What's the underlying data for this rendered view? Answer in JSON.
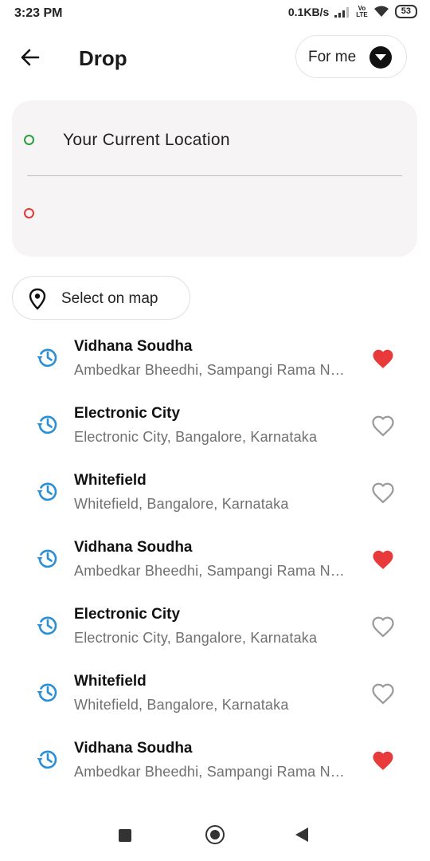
{
  "status_bar": {
    "time": "3:23 PM",
    "network_speed": "0.1KB/s",
    "battery": "53"
  },
  "header": {
    "title": "Drop",
    "for_me_label": "For me"
  },
  "locations": {
    "pickup": "Your Current Location",
    "drop_value": ""
  },
  "select_on_map": {
    "label": "Select on map"
  },
  "recent_places": [
    {
      "name": "Vidhana Soudha",
      "address": "Ambedkar Bheedhi, Sampangi Rama Nagar, Bengaluru, Karnataka",
      "favorite": true
    },
    {
      "name": "Electronic City",
      "address": "Electronic City, Bangalore, Karnataka",
      "favorite": false
    },
    {
      "name": "Whitefield",
      "address": "Whitefield, Bangalore, Karnataka",
      "favorite": false
    },
    {
      "name": "Vidhana Soudha",
      "address": "Ambedkar Bheedhi, Sampangi Rama Nagar, Bengaluru, Karnataka",
      "favorite": true
    },
    {
      "name": "Electronic City",
      "address": "Electronic City, Bangalore, Karnataka",
      "favorite": false
    },
    {
      "name": "Whitefield",
      "address": "Whitefield, Bangalore, Karnataka",
      "favorite": false
    },
    {
      "name": "Vidhana Soudha",
      "address": "Ambedkar Bheedhi, Sampangi Rama Nagar, Bengaluru, Karnataka",
      "favorite": true
    }
  ],
  "colors": {
    "history_icon": "#2a8fd6",
    "favorite_active": "#e83a3a",
    "favorite_inactive": "#9a9a9a",
    "pickup_dot": "#2e9d3d",
    "drop_dot": "#e03b3b"
  },
  "icons": {
    "back": "arrow-left-icon",
    "for_me": "chevron-down-icon",
    "map": "map-pin-icon",
    "history": "history-icon",
    "favorite": "heart-icon"
  }
}
